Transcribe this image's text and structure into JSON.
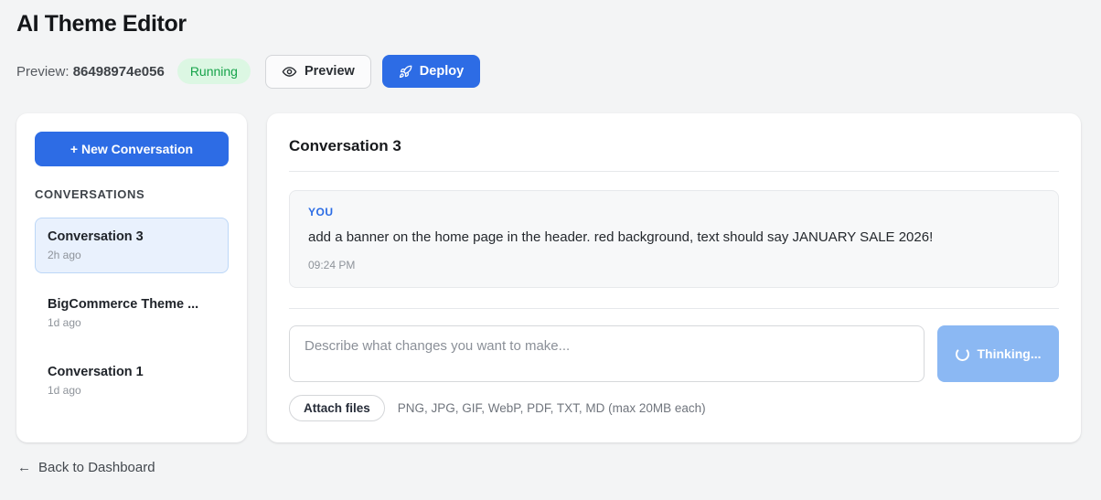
{
  "colors": {
    "primary_blue": "#2d6ce5",
    "disabled_blue": "#8bb8f3",
    "badge_bg": "#dcf7e3",
    "badge_text": "#16a34a",
    "page_bg": "#f3f4f5",
    "selected_item_bg": "#e9f1fd",
    "selected_item_border": "#bcd7f7"
  },
  "header": {
    "title": "AI Theme Editor",
    "preview_label": "Preview:",
    "preview_id": "86498974e056",
    "status_badge": "Running",
    "preview_button": "Preview",
    "deploy_button": "Deploy"
  },
  "sidebar": {
    "new_conversation_button": "+ New Conversation",
    "section_title": "CONVERSATIONS",
    "items": [
      {
        "title": "Conversation 3",
        "time": "2h ago",
        "selected": true
      },
      {
        "title": "BigCommerce Theme ...",
        "time": "1d ago",
        "selected": false
      },
      {
        "title": "Conversation 1",
        "time": "1d ago",
        "selected": false
      }
    ]
  },
  "conversation": {
    "title": "Conversation 3",
    "messages": [
      {
        "role": "YOU",
        "text": "add a banner on the home page in the header. red background, text should say JANUARY SALE 2026!",
        "time": "09:24 PM"
      }
    ]
  },
  "composer": {
    "placeholder": "Describe what changes you want to make...",
    "send_button": "Thinking...",
    "attach_button": "Attach files",
    "attach_hint": "PNG, JPG, GIF, WebP, PDF, TXT, MD (max 20MB each)"
  },
  "footer": {
    "back_arrow": "←",
    "back_link": "Back to Dashboard"
  }
}
